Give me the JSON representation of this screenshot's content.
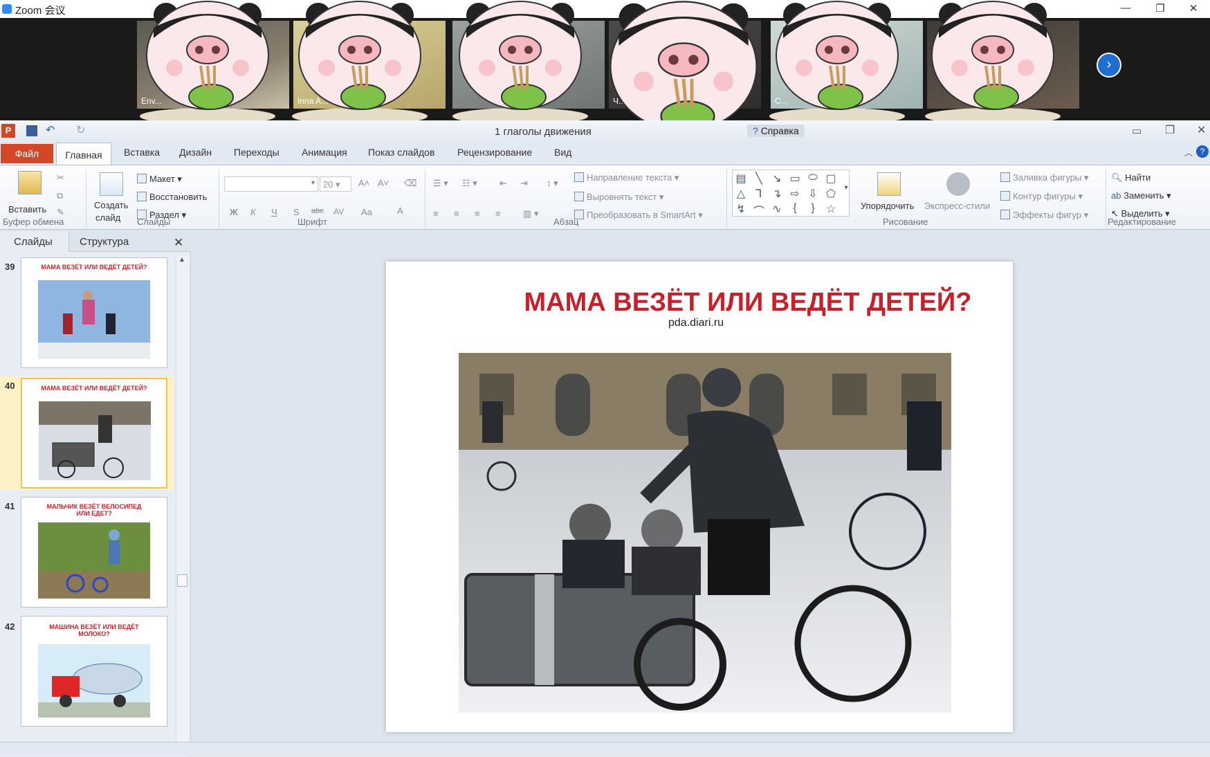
{
  "zoom": {
    "title": "Zoom 会议",
    "participants": [
      {
        "name": "Env..."
      },
      {
        "name": "Inna A..."
      },
      {
        "name": ""
      },
      {
        "name": "Ч..."
      },
      {
        "name": "C..."
      },
      {
        "name": ""
      }
    ],
    "next_icon": "chevron-right-icon"
  },
  "ppt": {
    "doc_title": "1 глаголы движения",
    "help_label": "Справка",
    "tabs": [
      "Файл",
      "Главная",
      "Вставка",
      "Дизайн",
      "Переходы",
      "Анимация",
      "Показ слайдов",
      "Рецензирование",
      "Вид"
    ],
    "ribbon": {
      "paste": "Вставить",
      "create_slide_1": "Создать",
      "create_slide_2": "слайд",
      "layout": "Макет",
      "reset": "Восстановить",
      "section": "Раздел",
      "font_size": "20",
      "text_direction": "Направление текста",
      "align_text": "Выровнять текст",
      "smartart": "Преобразовать в SmartArt",
      "arrange": "Упорядочить",
      "quick_styles": "Экспресс-стили",
      "shape_fill": "Заливка фигуры",
      "shape_outline": "Контур фигуры",
      "shape_effects": "Эффекты фигур",
      "find": "Найти",
      "replace": "Заменить",
      "select": "Выделить",
      "groups": [
        "Буфер обмена",
        "Слайды",
        "Шрифт",
        "Абзац",
        "Рисование",
        "Редактирование"
      ],
      "font_buttons": [
        "Ж",
        "К",
        "Ч",
        "S",
        "abc",
        "AV",
        "Aa",
        "A"
      ]
    },
    "pane_tabs": [
      "Слайды",
      "Структура"
    ],
    "thumbnails": [
      {
        "num": "39",
        "title": "МАМА ВЕЗЁТ ИЛИ ВЕДЁТ ДЕТЕЙ?",
        "selected": false
      },
      {
        "num": "40",
        "title": "МАМА ВЕЗЁТ ИЛИ ВЕДЁТ ДЕТЕЙ?",
        "selected": true
      },
      {
        "num": "41",
        "title": "МАЛЬЧИК ВЕЗЁТ ВЕЛОСИПЕД ИЛИ ЕДЕТ?",
        "selected": false
      },
      {
        "num": "42",
        "title": "МАШИНА ВЕЗЁТ ИЛИ ВЕДЁТ МОЛОКО?",
        "selected": false
      }
    ],
    "slide": {
      "title": "МАМА  ВЕЗЁТ ИЛИ ВЕДЁТ ДЕТЕЙ?",
      "source": "pda.diari.ru"
    },
    "colors": {
      "file_tab": "#d24726",
      "title_red": "#c8202a",
      "selected_thumb": "#f2c14e"
    }
  }
}
